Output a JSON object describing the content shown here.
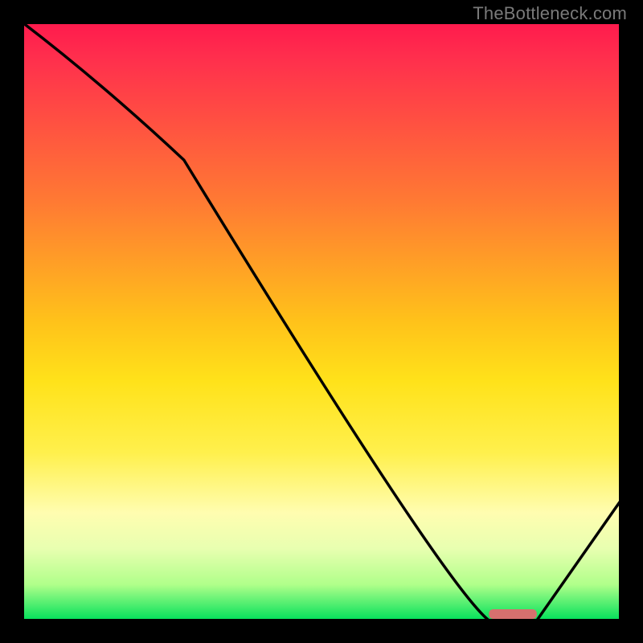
{
  "watermark": "TheBottleneck.com",
  "chart_data": {
    "type": "line",
    "title": "",
    "xlabel": "",
    "ylabel": "",
    "xlim": [
      0,
      100
    ],
    "ylim": [
      0,
      100
    ],
    "x": [
      0,
      27,
      78,
      86,
      100
    ],
    "y": [
      100,
      77,
      0,
      0,
      20
    ],
    "optimal_band": {
      "x_start": 78,
      "x_end": 86,
      "color": "#d6706e"
    },
    "gradient_stops": [
      {
        "offset": 0.0,
        "color": "#ff1a4d"
      },
      {
        "offset": 0.06,
        "color": "#ff2f4d"
      },
      {
        "offset": 0.3,
        "color": "#ff7a33"
      },
      {
        "offset": 0.5,
        "color": "#ffc21a"
      },
      {
        "offset": 0.6,
        "color": "#ffe21a"
      },
      {
        "offset": 0.72,
        "color": "#fff04d"
      },
      {
        "offset": 0.82,
        "color": "#fffdb0"
      },
      {
        "offset": 0.88,
        "color": "#e8ffb0"
      },
      {
        "offset": 0.94,
        "color": "#b0ff8a"
      },
      {
        "offset": 1.0,
        "color": "#00e05a"
      }
    ]
  },
  "plot_geometry": {
    "inner_x": 28,
    "inner_y": 28,
    "inner_w": 744,
    "inner_h": 744
  }
}
